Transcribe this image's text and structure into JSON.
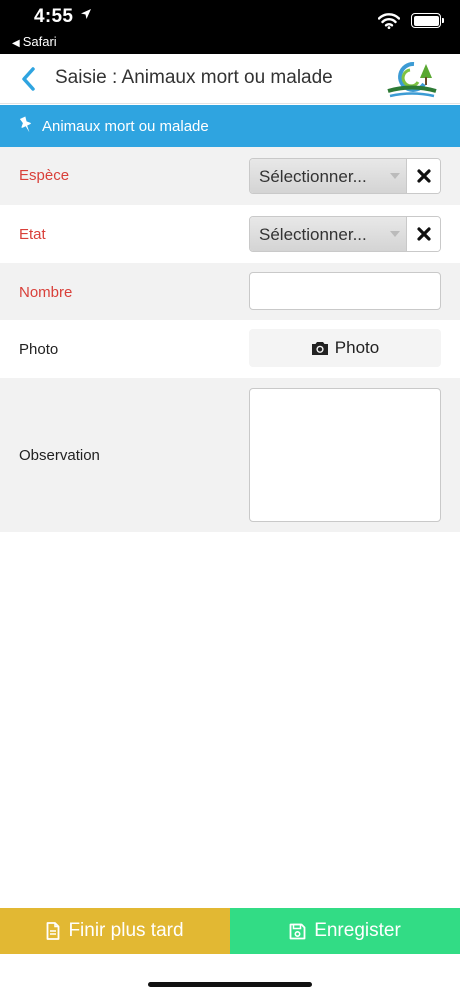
{
  "status_bar": {
    "time": "4:55",
    "back_app": "Safari"
  },
  "header": {
    "title": "Saisie : Animaux mort ou malade"
  },
  "section": {
    "title": "Animaux mort ou malade"
  },
  "form": {
    "espece": {
      "label": "Espèce",
      "value": "Sélectionner..."
    },
    "etat": {
      "label": "Etat",
      "value": "Sélectionner..."
    },
    "nombre": {
      "label": "Nombre",
      "value": ""
    },
    "photo": {
      "label": "Photo",
      "button_label": "Photo"
    },
    "observation": {
      "label": "Observation",
      "value": ""
    }
  },
  "footer": {
    "later_label": "Finir plus tard",
    "save_label": "Enregister"
  },
  "colors": {
    "banner": "#2fa4e0",
    "required_label": "#d9403a",
    "later_button": "#e2b833",
    "save_button": "#32dc85",
    "back_chevron": "#2fa4e0"
  },
  "icons": {
    "back": "chevron-left-icon",
    "section": "thumbtack-icon",
    "clear": "close-icon",
    "photo": "camera-icon",
    "later": "file-icon",
    "save": "floppy-disk-icon"
  }
}
